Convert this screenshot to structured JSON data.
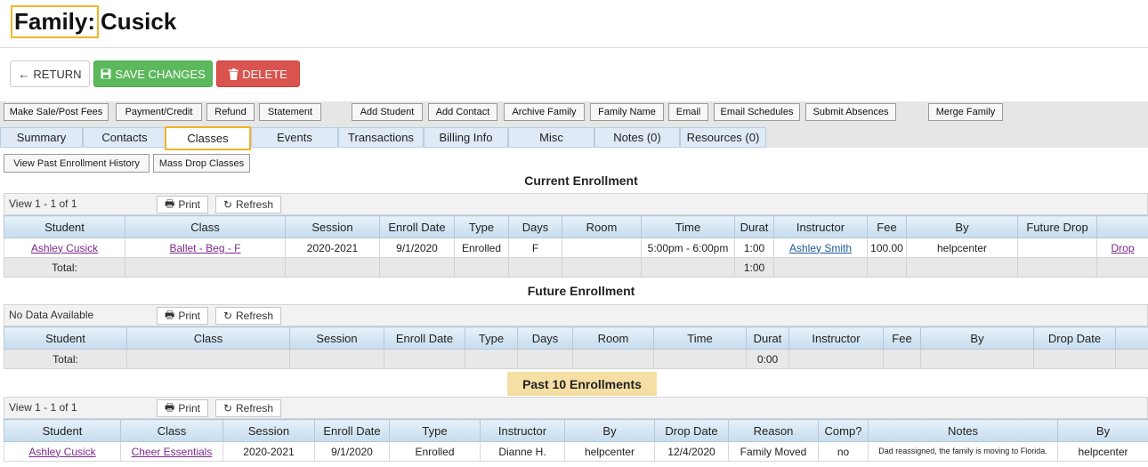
{
  "header": {
    "family_label": "Family:",
    "family_name": "Cusick"
  },
  "actions": {
    "return_label": "RETURN",
    "save_label": "SAVE CHANGES",
    "delete_label": "DELETE"
  },
  "toolbar": {
    "make_sale": "Make Sale/Post Fees",
    "payment": "Payment/Credit",
    "refund": "Refund",
    "statement": "Statement",
    "add_student": "Add Student",
    "add_contact": "Add Contact",
    "archive": "Archive Family",
    "family_name": "Family Name",
    "email": "Email",
    "email_schedules": "Email Schedules",
    "submit_absences": "Submit Absences",
    "merge": "Merge Family"
  },
  "tabs": [
    "Summary",
    "Contacts",
    "Classes",
    "Events",
    "Transactions",
    "Billing Info",
    "Misc",
    "Notes (0)",
    "Resources (0)"
  ],
  "sub_actions": {
    "past_history": "View Past Enrollment History",
    "mass_drop": "Mass Drop Classes"
  },
  "common": {
    "print": "Print",
    "refresh": "Refresh",
    "total": "Total:"
  },
  "current": {
    "title": "Current Enrollment",
    "pager": "View 1 - 1 of 1",
    "columns": [
      "Student",
      "Class",
      "Session",
      "Enroll Date",
      "Type",
      "Days",
      "Room",
      "Time",
      "Durat",
      "Instructor",
      "Fee",
      "By",
      "Future Drop",
      ""
    ],
    "row": {
      "student": "Ashley Cusick",
      "class": "Ballet - Beg - F",
      "session": "2020-2021",
      "enroll_date": "9/1/2020",
      "type": "Enrolled",
      "days": "F",
      "room": "",
      "time": "5:00pm - 6:00pm",
      "duration": "1:00",
      "instructor": "Ashley Smith",
      "fee": "100.00",
      "by": "helpcenter",
      "future_drop": "",
      "action": "Drop"
    },
    "total_duration": "1:00"
  },
  "future": {
    "title": "Future Enrollment",
    "pager": "No Data Available",
    "columns": [
      "Student",
      "Class",
      "Session",
      "Enroll Date",
      "Type",
      "Days",
      "Room",
      "Time",
      "Durat",
      "Instructor",
      "Fee",
      "By",
      "Drop Date",
      ""
    ],
    "total_duration": "0:00"
  },
  "past": {
    "title": "Past 10 Enrollments",
    "pager": "View 1 - 1 of 1",
    "columns": [
      "Student",
      "Class",
      "Session",
      "Enroll Date",
      "Type",
      "Instructor",
      "By",
      "Drop Date",
      "Reason",
      "Comp?",
      "Notes",
      "By"
    ],
    "row": {
      "student": "Ashley Cusick",
      "class": "Cheer Essentials",
      "session": "2020-2021",
      "enroll_date": "9/1/2020",
      "type": "Enrolled",
      "instructor": "Dianne H.",
      "by": "helpcenter",
      "drop_date": "12/4/2020",
      "reason": "Family Moved",
      "comp": "no",
      "notes": "Dad reassigned, the family is moving to Florida.",
      "by2": "helpcenter"
    }
  },
  "colors": {
    "save": "#5cb85c",
    "delete": "#d9534f",
    "highlight": "#f0b429",
    "header_blue": "#c6dced",
    "past_banner": "#f6dfa4"
  }
}
